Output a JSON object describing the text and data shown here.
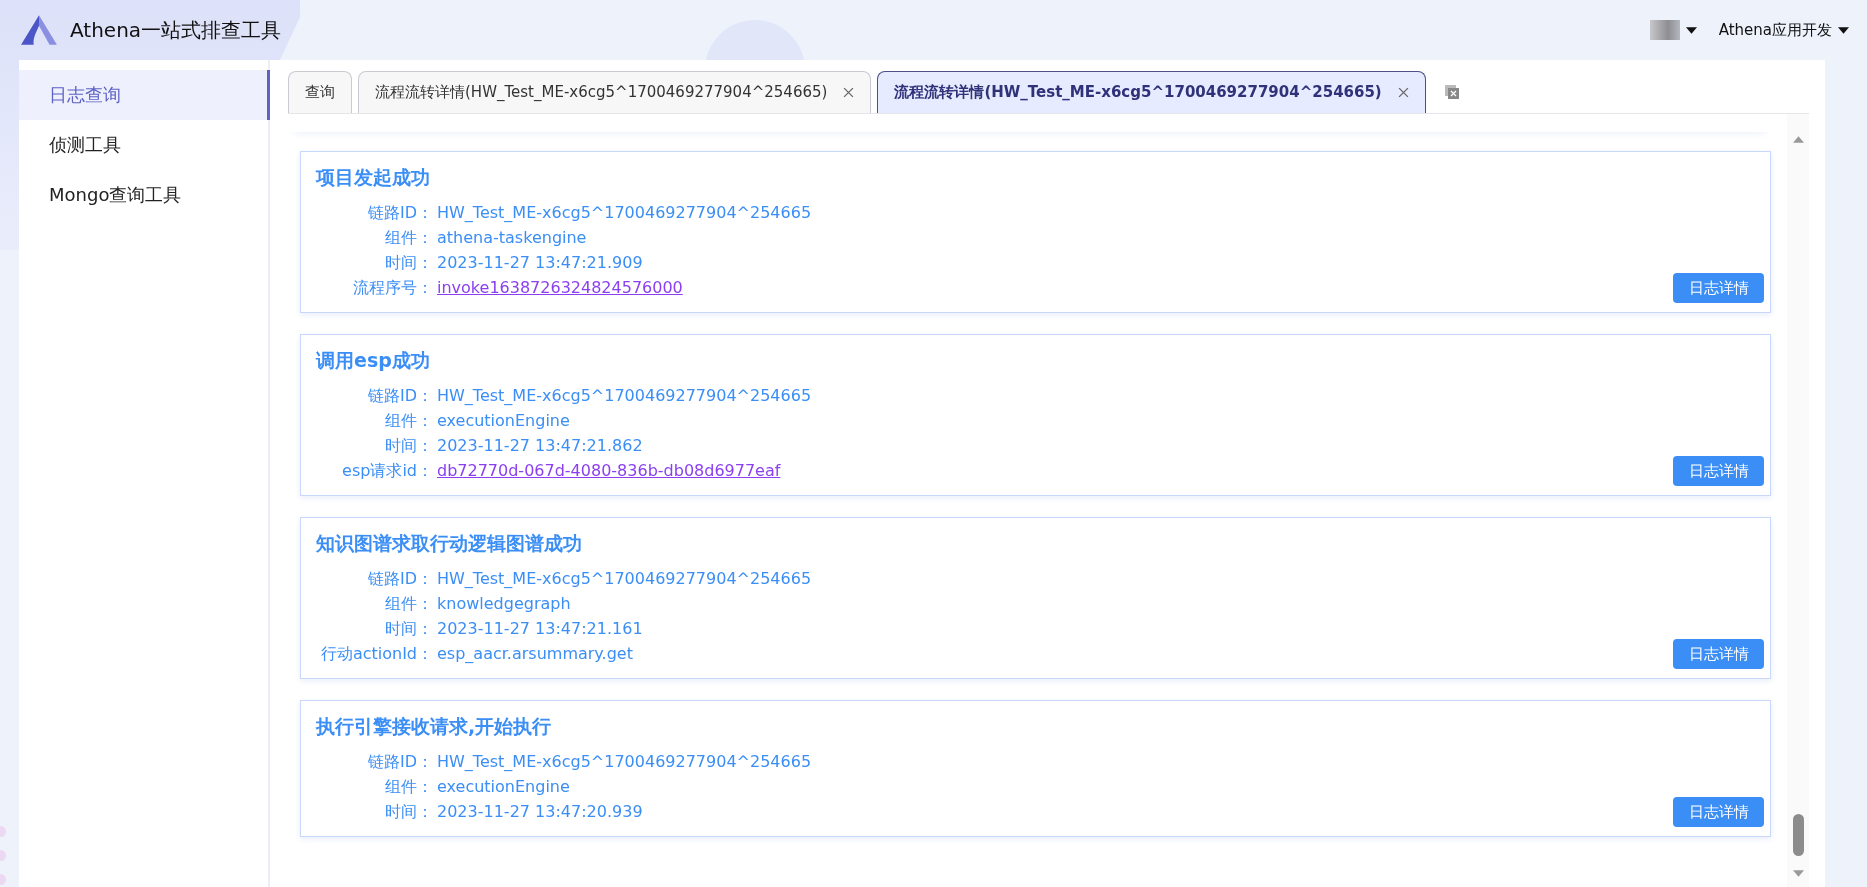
{
  "header": {
    "title": "Athena一站式排查工具",
    "app_menu": "Athena应用开发"
  },
  "sidebar": {
    "items": [
      {
        "label": "日志查询",
        "selected": true
      },
      {
        "label": "侦测工具",
        "selected": false
      },
      {
        "label": "Mongo查询工具",
        "selected": false
      }
    ]
  },
  "tabs": [
    {
      "label": "查询",
      "selected": false,
      "closable": false
    },
    {
      "label": "流程流转详情(HW_Test_ME-x6cg5^1700469277904^254665)",
      "selected": false,
      "closable": true
    },
    {
      "label": "流程流转详情(HW_Test_ME-x6cg5^1700469277904^254665)",
      "selected": true,
      "closable": true
    }
  ],
  "close_all_tabs_button": true,
  "cards": [
    {
      "title": "项目发起成功",
      "fields": [
        {
          "label": "链路ID：",
          "value": "HW_Test_ME-x6cg5^1700469277904^254665",
          "link": false
        },
        {
          "label": "组件：",
          "value": "athena-taskengine",
          "link": false
        },
        {
          "label": "时间：",
          "value": "2023-11-27 13:47:21.909",
          "link": false
        },
        {
          "label": "流程序号：",
          "value": "invoke1638726324824576000",
          "link": true
        }
      ],
      "button": "日志详情"
    },
    {
      "title": "调用esp成功",
      "fields": [
        {
          "label": "链路ID：",
          "value": "HW_Test_ME-x6cg5^1700469277904^254665",
          "link": false
        },
        {
          "label": "组件：",
          "value": "executionEngine",
          "link": false
        },
        {
          "label": "时间：",
          "value": "2023-11-27 13:47:21.862",
          "link": false
        },
        {
          "label": "esp请求id：",
          "value": "db72770d-067d-4080-836b-db08d6977eaf",
          "link": true
        }
      ],
      "button": "日志详情"
    },
    {
      "title": "知识图谱求取行动逻辑图谱成功",
      "fields": [
        {
          "label": "链路ID：",
          "value": "HW_Test_ME-x6cg5^1700469277904^254665",
          "link": false
        },
        {
          "label": "组件：",
          "value": "knowledgegraph",
          "link": false
        },
        {
          "label": "时间：",
          "value": "2023-11-27 13:47:21.161",
          "link": false
        },
        {
          "label": "行动actionId：",
          "value": "esp_aacr.arsummary.get",
          "link": false
        }
      ],
      "button": "日志详情"
    },
    {
      "title": "执行引擎接收请求,开始执行",
      "fields": [
        {
          "label": "链路ID：",
          "value": "HW_Test_ME-x6cg5^1700469277904^254665",
          "link": false
        },
        {
          "label": "组件：",
          "value": "executionEngine",
          "link": false
        },
        {
          "label": "时间：",
          "value": "2023-11-27 13:47:20.939",
          "link": false
        }
      ],
      "button": "日志详情"
    }
  ]
}
